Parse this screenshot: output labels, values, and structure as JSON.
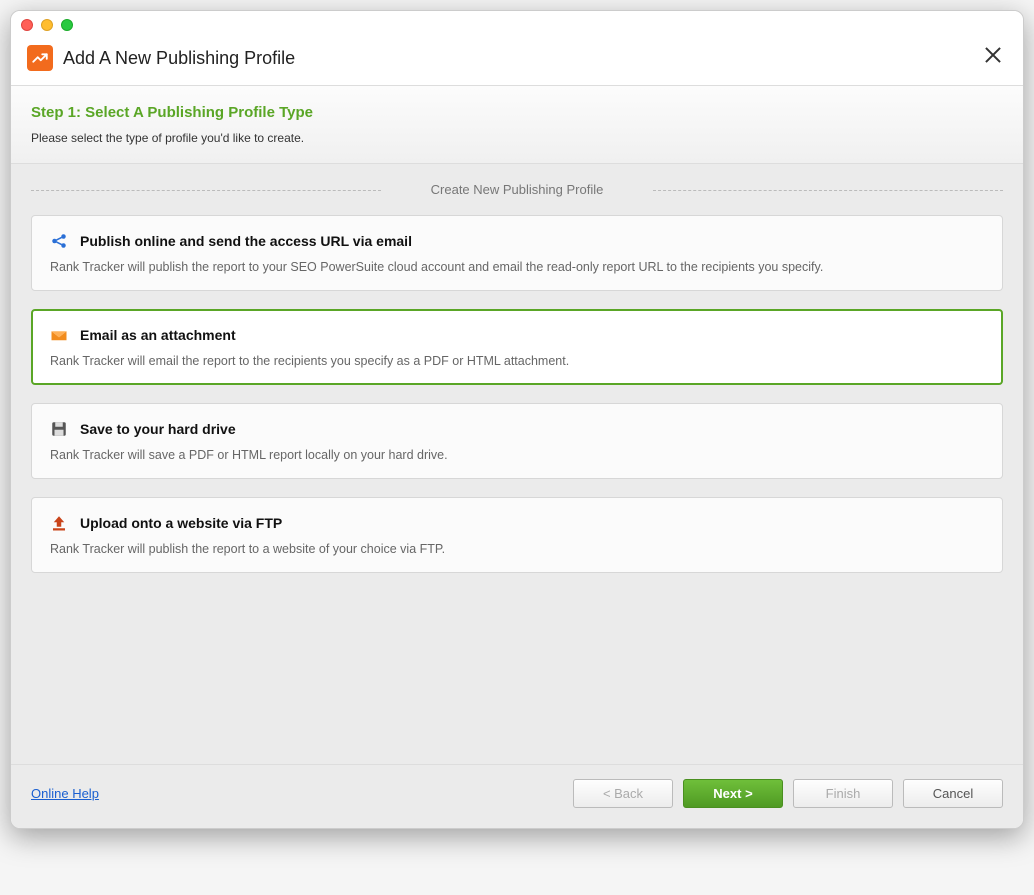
{
  "window": {
    "title": "Add A New Publishing Profile"
  },
  "subheader": {
    "step_title": "Step 1: Select A Publishing Profile Type",
    "step_desc": "Please select the type of profile you'd like to create."
  },
  "fieldset": {
    "legend": "Create New Publishing Profile"
  },
  "options": [
    {
      "title": "Publish online and send the access URL via email",
      "desc": "Rank Tracker will publish the report to your SEO PowerSuite cloud account and email the read-only report URL to the recipients you specify.",
      "icon": "share-icon"
    },
    {
      "title": "Email as an attachment",
      "desc": "Rank Tracker will email the report to the recipients you specify as a PDF or HTML attachment.",
      "icon": "mail-icon",
      "selected": true
    },
    {
      "title": "Save to your hard drive",
      "desc": "Rank Tracker will save a PDF or HTML report locally on your hard drive.",
      "icon": "save-icon"
    },
    {
      "title": "Upload onto a website via FTP",
      "desc": "Rank Tracker will publish the report to a website of your choice via FTP.",
      "icon": "upload-icon"
    }
  ],
  "footer": {
    "help": "Online Help",
    "back": "< Back",
    "next": "Next >",
    "finish": "Finish",
    "cancel": "Cancel"
  }
}
